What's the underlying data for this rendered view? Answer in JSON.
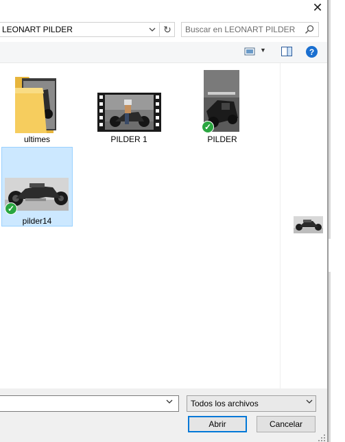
{
  "address": {
    "path": "LEONART PILDER"
  },
  "search": {
    "placeholder": "Buscar en LEONART PILDER"
  },
  "files": [
    {
      "name": "ultimes",
      "kind": "folder"
    },
    {
      "name": "PILDER 1",
      "kind": "video"
    },
    {
      "name": "PILDER",
      "kind": "image",
      "synced": true
    },
    {
      "name": "pilder14",
      "kind": "image",
      "synced": true,
      "selected": true
    }
  ],
  "filter": {
    "selected": "Todos los archivos"
  },
  "buttons": {
    "open": "Abrir",
    "cancel": "Cancelar"
  },
  "colors": {
    "selection": "#cce8ff",
    "help": "#1a6fd0",
    "sync_check": "#2aa640",
    "folder": "#f0c65a"
  }
}
